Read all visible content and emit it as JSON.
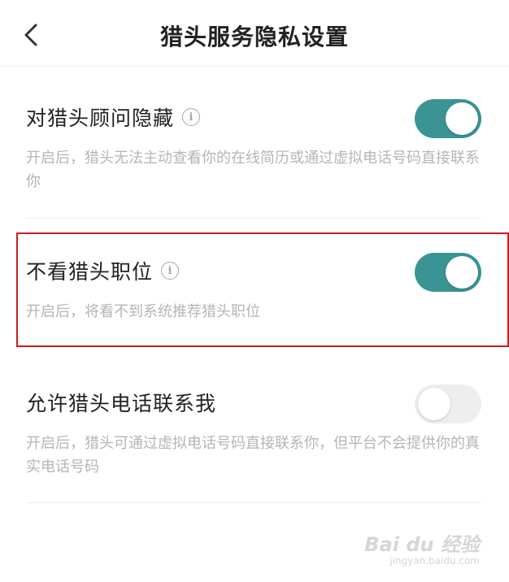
{
  "header": {
    "title": "猎头服务隐私设置",
    "back_icon": "chevron-left-icon"
  },
  "settings": [
    {
      "title": "对猎头顾问隐藏",
      "has_info": true,
      "info_glyph": "i",
      "description": "开启后，猎头无法主动查看你的在线简历或通过虚拟电话号码直接联系你",
      "enabled": true
    },
    {
      "title": "不看猎头职位",
      "has_info": true,
      "info_glyph": "i",
      "description": "开启后，将看不到系统推荐猎头职位",
      "enabled": true
    },
    {
      "title": "允许猎头电话联系我",
      "has_info": false,
      "description": "开启后，猎头可通过虚拟电话号码直接联系你，但平台不会提供你的真实电话号码",
      "enabled": false
    }
  ],
  "colors": {
    "toggle_on": "#3a9494",
    "toggle_off": "#eeeeee",
    "highlight": "#c81e1e"
  },
  "watermark": {
    "logo": "Bai du 经验",
    "url": "jingyan.baidu.com"
  }
}
